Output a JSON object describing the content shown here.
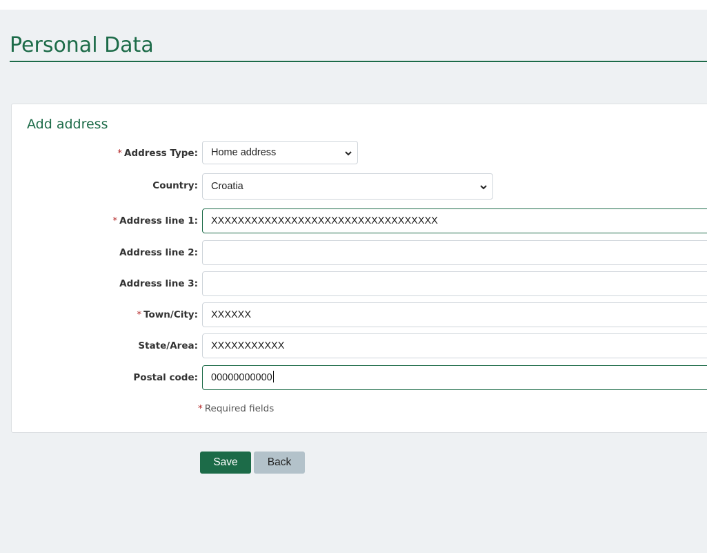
{
  "page": {
    "title": "Personal Data"
  },
  "form": {
    "section_title": "Add address",
    "fields": {
      "address_type": {
        "label": "Address Type:",
        "required": true,
        "value": "Home address"
      },
      "country": {
        "label": "Country:",
        "required": false,
        "value": "Croatia"
      },
      "address_line_1": {
        "label": "Address line 1:",
        "required": true,
        "value": "XXXXXXXXXXXXXXXXXXXXXXXXXXXXXXXXXX"
      },
      "address_line_2": {
        "label": "Address line 2:",
        "required": false,
        "value": ""
      },
      "address_line_3": {
        "label": "Address line 3:",
        "required": false,
        "value": ""
      },
      "town_city": {
        "label": "Town/City:",
        "required": true,
        "value": "XXXXXX"
      },
      "state_area": {
        "label": "State/Area:",
        "required": false,
        "value": "XXXXXXXXXXX"
      },
      "postal_code": {
        "label": "Postal code:",
        "required": false,
        "value": "00000000000"
      }
    },
    "required_star": "*",
    "required_note": "Required fields"
  },
  "actions": {
    "save_label": "Save",
    "back_label": "Back"
  },
  "icons": {
    "select_chevron": "chevron-down-icon"
  },
  "colors": {
    "brand_green": "#1c6b48",
    "required_red": "#b52b2b",
    "back_button": "#b3c2ca",
    "background": "#eef1f3"
  }
}
